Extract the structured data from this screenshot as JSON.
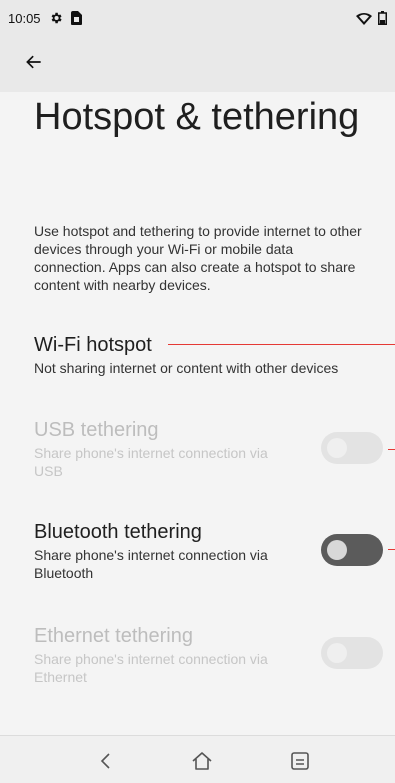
{
  "status_bar": {
    "time": "10:05",
    "icons_left": [
      "gear-icon",
      "sim-card-icon"
    ],
    "icons_right": [
      "wifi-icon",
      "battery-icon"
    ]
  },
  "app_bar": {
    "back_icon": "arrow-left-icon"
  },
  "page": {
    "title": "Hotspot & tethering",
    "description": "Use hotspot and tethering to provide internet to other devices through your Wi-Fi or mobile data connection. Apps can also create a hotspot to share content with nearby devices."
  },
  "settings": [
    {
      "title": "Wi-Fi hotspot",
      "subtitle": "Not sharing internet or content with other devices",
      "enabled": true,
      "toggle": null
    },
    {
      "title": "USB tethering",
      "subtitle": "Share phone's internet connection via USB",
      "enabled": false,
      "toggle": "off"
    },
    {
      "title": "Bluetooth tethering",
      "subtitle": "Share phone's internet connection via Bluetooth",
      "enabled": true,
      "toggle": "off"
    },
    {
      "title": "Ethernet tethering",
      "subtitle": "Share phone's internet connection via Ethernet",
      "enabled": false,
      "toggle": "off"
    }
  ],
  "nav_bar": {
    "icons": [
      "back-chevron-icon",
      "home-icon",
      "recents-icon"
    ]
  },
  "colors": {
    "accent_line": "#e53935",
    "toggle_off": "#5b5b5b",
    "disabled_text": "#bdbdbd"
  }
}
